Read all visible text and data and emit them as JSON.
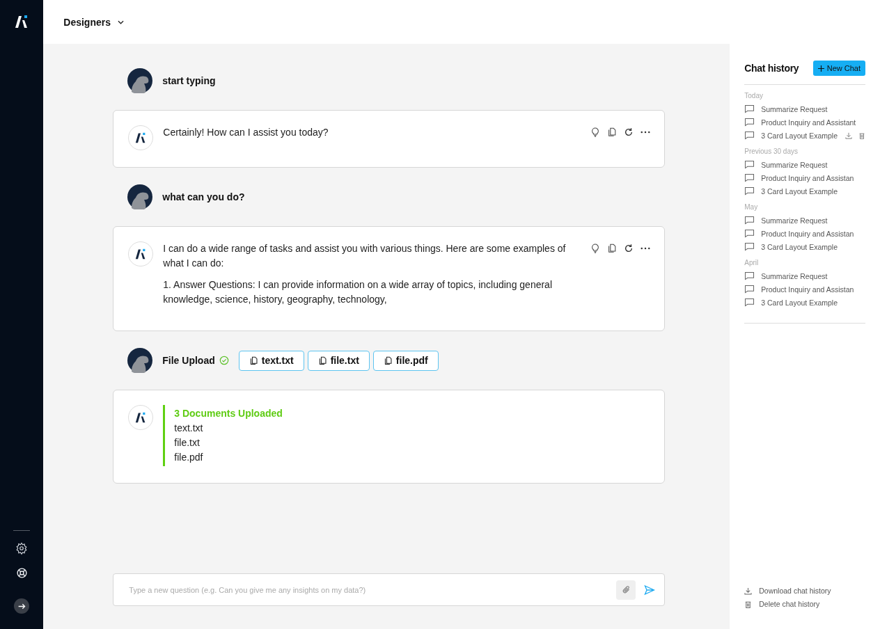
{
  "workspace": {
    "title": "Designers"
  },
  "messages": [
    {
      "kind": "user",
      "text": "start typing"
    },
    {
      "kind": "assistant",
      "paragraphs": [
        "Certainly! How can I assist you today?"
      ]
    },
    {
      "kind": "user",
      "text": "what can you do?"
    },
    {
      "kind": "assistant",
      "paragraphs": [
        "I can do a wide range of tasks and assist you with various things. Here are some examples of what I can do:",
        "1. Answer Questions: I can provide information on a wide array of topics, including general knowledge, science, history, geography, technology,"
      ]
    },
    {
      "kind": "upload",
      "text": "File Upload",
      "done": true,
      "files": [
        "text.txt",
        "file.txt",
        "file.pdf"
      ]
    },
    {
      "kind": "documents",
      "title": "3 Documents Uploaded",
      "files": [
        "text.txt",
        "file.txt",
        "file.pdf"
      ]
    }
  ],
  "composer": {
    "placeholder": "Type a new question (e.g. Can you give me any insights on my data?)"
  },
  "history": {
    "title": "Chat history",
    "new_chat": "New Chat",
    "groups": [
      {
        "label": "Today",
        "items": [
          {
            "title": "Summarize Request",
            "hovered": false
          },
          {
            "title": "Product Inquiry and Assistant",
            "hovered": false
          },
          {
            "title": "3 Card Layout Example",
            "hovered": true
          }
        ]
      },
      {
        "label": "Previous 30 days",
        "items": [
          {
            "title": "Summarize Request",
            "hovered": false
          },
          {
            "title": "Product Inquiry and Assistan",
            "hovered": false
          },
          {
            "title": "3 Card Layout Example",
            "hovered": false
          }
        ]
      },
      {
        "label": "May",
        "items": [
          {
            "title": "Summarize Request",
            "hovered": false
          },
          {
            "title": "Product Inquiry and Assistan",
            "hovered": false
          },
          {
            "title": "3 Card Layout Example",
            "hovered": false
          }
        ]
      },
      {
        "label": "April",
        "items": [
          {
            "title": "Summarize Request",
            "hovered": false
          },
          {
            "title": "Product Inquiry and Assistan",
            "hovered": false
          },
          {
            "title": "3 Card Layout Example",
            "hovered": false
          }
        ]
      }
    ],
    "actions": [
      {
        "kind": "download",
        "label": "Download chat history"
      },
      {
        "kind": "delete",
        "label": "Delete chat history"
      }
    ]
  }
}
